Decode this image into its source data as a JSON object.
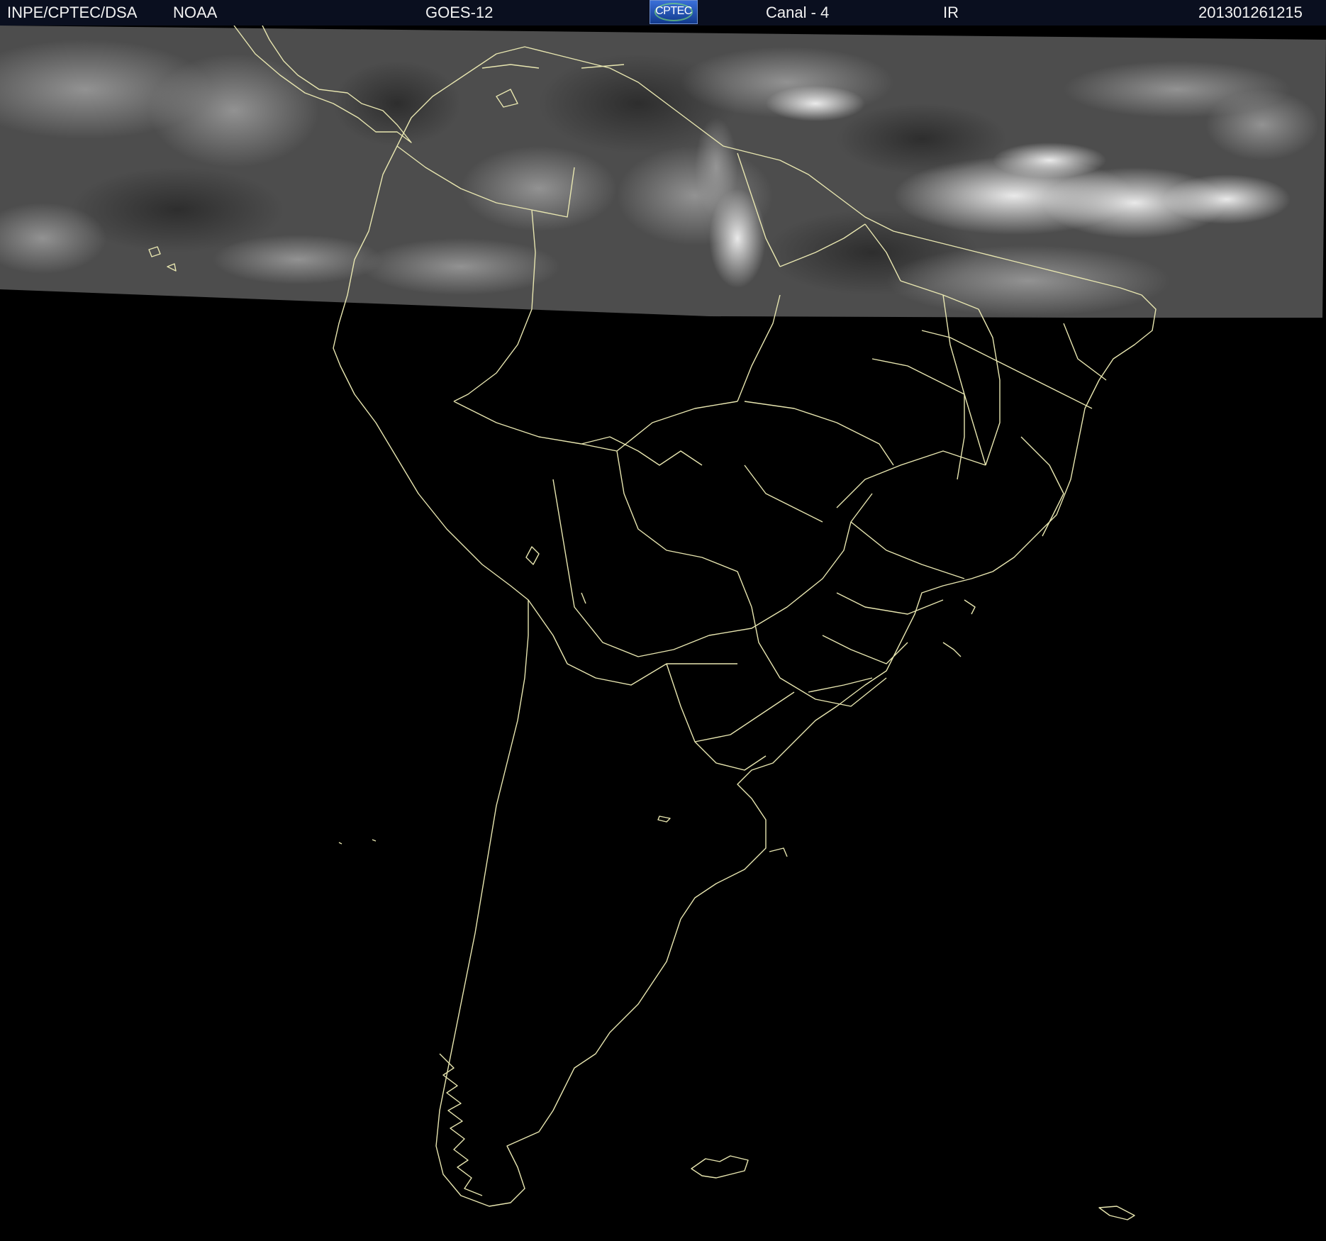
{
  "header": {
    "agency": "INPE/CPTEC/DSA",
    "source": "NOAA",
    "satellite": "GOES-12",
    "logo_text": "CPTEC",
    "channel": "Canal - 4",
    "band": "IR",
    "timestamp": "201301261215"
  },
  "colors": {
    "header_bg": "#0a0f1f",
    "map_bg": "#000000",
    "coastline": "#e8e6b0",
    "cloud_band": "#4a4a4a"
  },
  "map": {
    "region": "South America",
    "imagery": "infrared",
    "coverage": "partial (northern strip only)"
  }
}
